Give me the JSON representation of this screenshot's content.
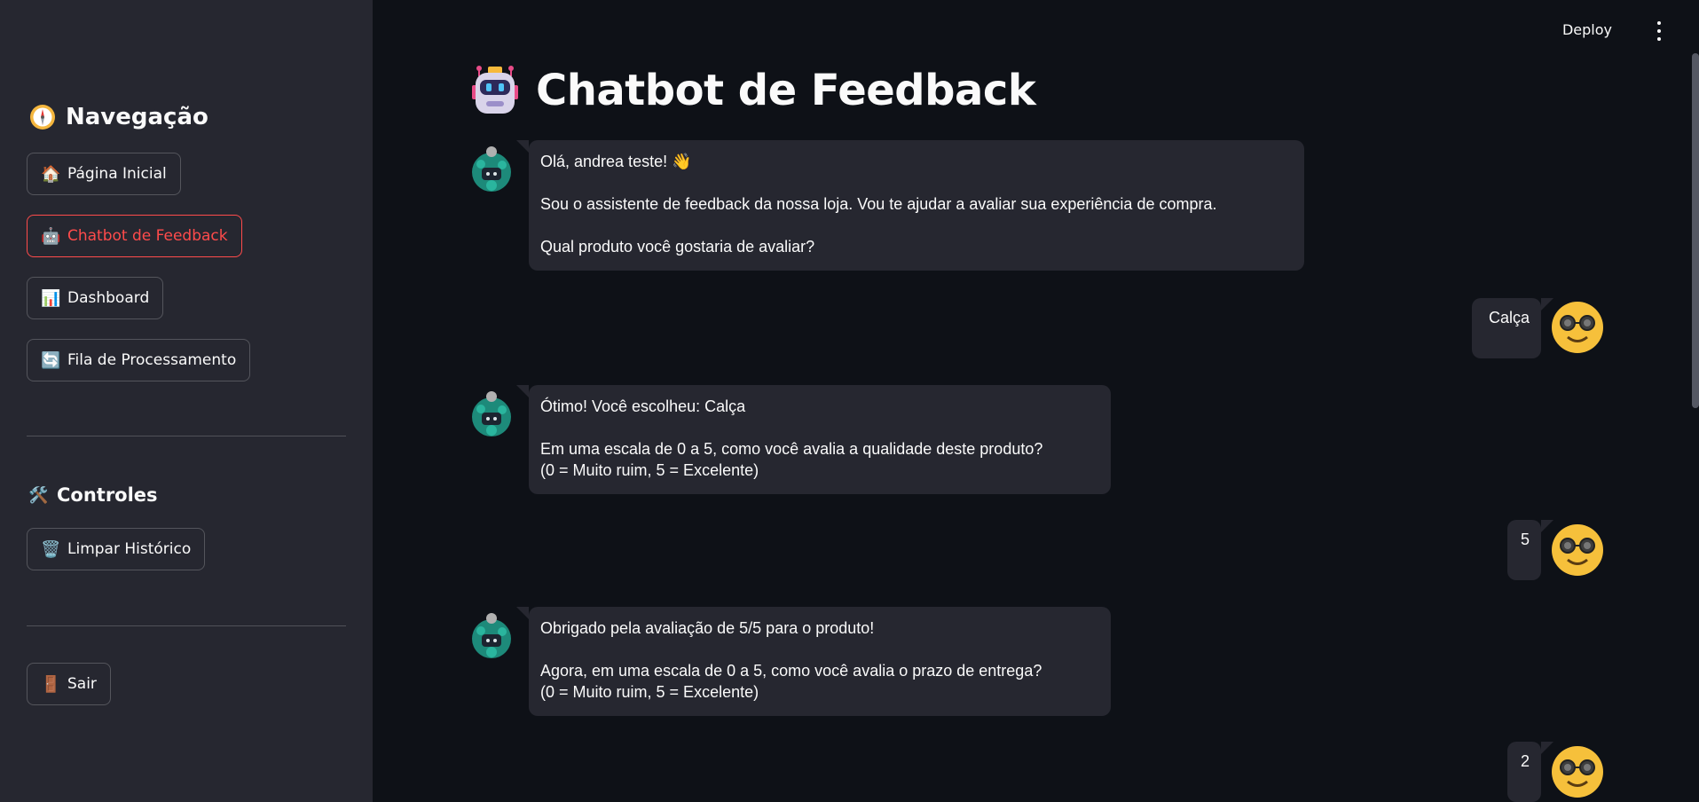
{
  "sidebar": {
    "nav_title": "Navegação",
    "nav_icon": "compass-icon",
    "nav_items": [
      {
        "icon": "🏠",
        "label": "Página Inicial",
        "active": false
      },
      {
        "icon": "🤖",
        "label": "Chatbot de Feedback",
        "active": true
      },
      {
        "icon": "📊",
        "label": "Dashboard",
        "active": false
      },
      {
        "icon": "🔄",
        "label": "Fila de Processamento",
        "active": false
      }
    ],
    "controls_title": "Controles",
    "controls_icon": "🛠️",
    "clear_history": {
      "icon": "🗑️",
      "label": "Limpar Histórico"
    },
    "logout": {
      "icon": "🚪",
      "label": "Sair"
    }
  },
  "header": {
    "deploy_label": "Deploy"
  },
  "main": {
    "title": "Chatbot de Feedback",
    "messages": [
      {
        "role": "assistant",
        "paragraphs": [
          "Olá, andrea teste! 👋",
          "Sou o assistente de feedback da nossa loja. Vou te ajudar a avaliar sua experiência de compra.",
          "Qual produto você gostaria de avaliar?"
        ]
      },
      {
        "role": "user",
        "text": "Calça"
      },
      {
        "role": "assistant",
        "paragraphs": [
          "Ótimo! Você escolheu: Calça",
          "Em uma escala de 0 a 5, como você avalia a qualidade deste produto?",
          "(0 = Muito ruim, 5 = Excelente)"
        ]
      },
      {
        "role": "user",
        "text": "5"
      },
      {
        "role": "assistant",
        "paragraphs": [
          "Obrigado pela avaliação de 5/5 para o produto!",
          "Agora, em uma escala de 0 a 5, como você avalia o prazo de entrega?",
          "(0 = Muito ruim, 5 = Excelente)"
        ]
      },
      {
        "role": "user",
        "text": "2"
      }
    ]
  },
  "colors": {
    "background": "#0e1117",
    "sidebar": "#262730",
    "accent": "#ff4b4b",
    "bubble": "#262730"
  }
}
